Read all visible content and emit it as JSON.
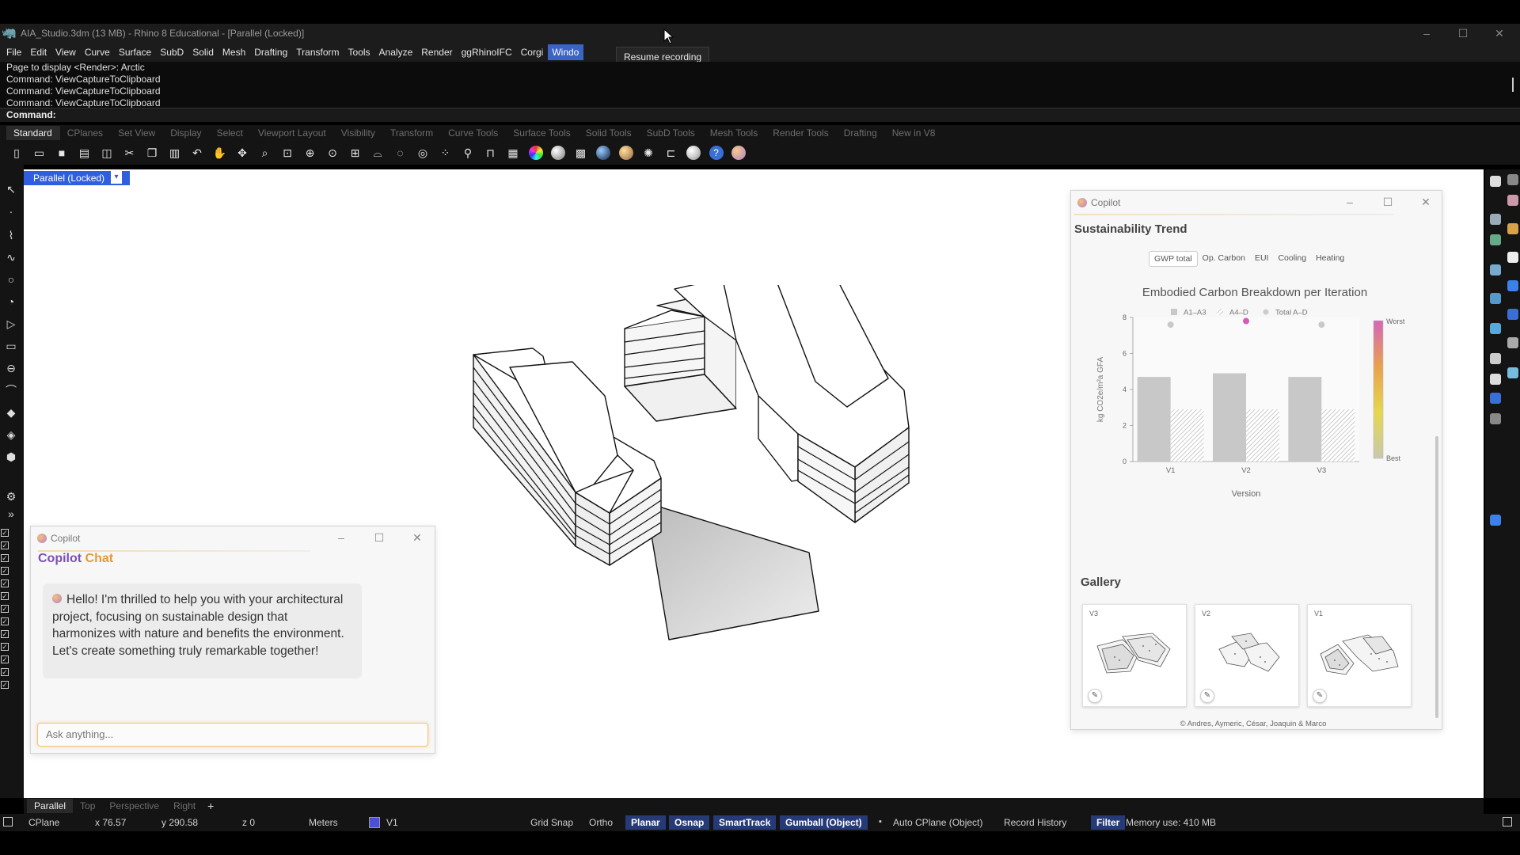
{
  "window": {
    "title": "AIA_Studio.3dm (13 MB) - Rhino 8 Educational - [Parallel (Locked)]",
    "controls": [
      "–",
      "☐",
      "✕"
    ]
  },
  "menu": [
    "File",
    "Edit",
    "View",
    "Curve",
    "Surface",
    "SubD",
    "Solid",
    "Mesh",
    "Drafting",
    "Transform",
    "Tools",
    "Analyze",
    "Render",
    "ggRhinoIFC",
    "Corgi",
    "Windo"
  ],
  "tooltip": "Resume recording",
  "command_history": [
    "Page to display <Render>: Arctic",
    "Command: ViewCaptureToClipboard",
    "Command: ViewCaptureToClipboard",
    "Command: ViewCaptureToClipboard"
  ],
  "command_prompt": "Command:",
  "toolbar_tabs": [
    "Standard",
    "CPlanes",
    "Set View",
    "Display",
    "Select",
    "Viewport Layout",
    "Visibility",
    "Transform",
    "Curve Tools",
    "Surface Tools",
    "Solid Tools",
    "SubD Tools",
    "Mesh Tools",
    "Render Tools",
    "Drafting",
    "New in V8"
  ],
  "viewport": {
    "label": "Parallel (Locked)",
    "tabs": [
      "Parallel",
      "Top",
      "Perspective",
      "Right"
    ],
    "add": "+"
  },
  "status": {
    "cplane": "CPlane",
    "x": "x 76.57",
    "y": "y 290.58",
    "z": "z 0",
    "units": "Meters",
    "layer": "V1",
    "grid_snap": "Grid Snap",
    "ortho": "Ortho",
    "planar": "Planar",
    "osnap": "Osnap",
    "smarttrack": "SmartTrack",
    "gumball": "Gumball (Object)",
    "auto_cplane": "Auto CPlane (Object)",
    "record_history": "Record History",
    "filter": "Filter",
    "memory": "Memory use: 410 MB",
    "layer_color": "#4b50d6"
  },
  "chat": {
    "window_title": "Copilot",
    "heading_a": "Copilot",
    "heading_b": "Chat",
    "message": "Hello! I'm thrilled to help you with your architectural project, focusing on sustainable design that harmonizes with nature and benefits the environment. Let's create something truly remarkable together!",
    "input_placeholder": "Ask anything..."
  },
  "sustainability": {
    "window_title": "Copilot",
    "title": "Sustainability Trend",
    "tabs": [
      "GWP total",
      "Op. Carbon",
      "EUI",
      "Cooling",
      "Heating"
    ],
    "active_tab": "GWP total",
    "gallery_title": "Gallery",
    "gallery": [
      {
        "label": "V3",
        "edit": "✎"
      },
      {
        "label": "V2",
        "edit": "✎"
      },
      {
        "label": "V1",
        "edit": "✎"
      }
    ],
    "credits": "© Andres, Aymeric, César, Joaquin & Marco"
  },
  "chart_data": {
    "type": "bar",
    "title": "Embodied Carbon Breakdown per Iteration",
    "xlabel": "Version",
    "ylabel": "kg CO2e/m²a GFA",
    "categories": [
      "V1",
      "V2",
      "V3"
    ],
    "series": [
      {
        "name": "A1–A3",
        "values": [
          4.7,
          4.9,
          4.7
        ],
        "color": "#c8c8c8",
        "pattern": "solid"
      },
      {
        "name": "A4–D",
        "values": [
          2.9,
          2.9,
          2.9
        ],
        "color": "#c8c8c8",
        "pattern": "hatch"
      },
      {
        "name": "Total A–D",
        "values": [
          7.6,
          7.8,
          7.6
        ],
        "marker": "dot"
      }
    ],
    "ylim": [
      0,
      8
    ],
    "yticks": [
      0,
      2,
      4,
      6,
      8
    ],
    "highlight_category": "V2",
    "highlight_color": "#d45cb6",
    "colorbar": {
      "top_label": "Worst",
      "bottom_label": "Best",
      "colors": [
        "#d466b8",
        "#e8a24e",
        "#e6d74f",
        "#c8c8b0"
      ]
    },
    "legend_position": "top"
  }
}
